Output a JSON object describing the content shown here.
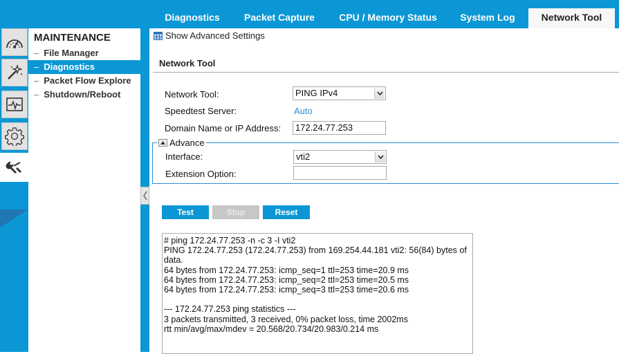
{
  "tabs": [
    {
      "label": "Diagnostics"
    },
    {
      "label": "Packet Capture"
    },
    {
      "label": "CPU / Memory Status"
    },
    {
      "label": "System Log"
    },
    {
      "label": "Network Tool",
      "active": true
    }
  ],
  "rail": [
    {
      "icon": "dashboard-icon"
    },
    {
      "icon": "wizard-icon"
    },
    {
      "icon": "monitor-icon"
    },
    {
      "icon": "gear-icon"
    },
    {
      "icon": "maintenance-tools-icon",
      "active": true
    }
  ],
  "menu": {
    "title": "MAINTENANCE",
    "dash": "–",
    "items": [
      {
        "label": "File Manager"
      },
      {
        "label": "Diagnostics",
        "active": true
      },
      {
        "label": "Packet Flow Explore"
      },
      {
        "label": "Shutdown/Reboot"
      }
    ]
  },
  "content": {
    "advanced_settings_label": "Show Advanced Settings",
    "section_title": "Network Tool",
    "form": {
      "network_tool_label": "Network Tool:",
      "network_tool_value": "PING IPv4",
      "speedtest_label": "Speedtest Server:",
      "speedtest_value": "Auto",
      "domain_label": "Domain Name or IP Address:",
      "domain_value": "172.24.77.253",
      "advance_legend": "Advance",
      "interface_label": "Interface:",
      "interface_value": "vti2",
      "extension_label": "Extension Option:",
      "extension_value": ""
    },
    "buttons": {
      "test": "Test",
      "stop": "Stop",
      "reset": "Reset"
    },
    "output": "# ping 172.24.77.253 -n -c 3 -I vti2\nPING 172.24.77.253 (172.24.77.253) from 169.254.44.181 vti2: 56(84) bytes of data.\n64 bytes from 172.24.77.253: icmp_seq=1 ttl=253 time=20.9 ms\n64 bytes from 172.24.77.253: icmp_seq=2 ttl=253 time=20.5 ms\n64 bytes from 172.24.77.253: icmp_seq=3 ttl=253 time=20.6 ms\n\n--- 172.24.77.253 ping statistics ---\n3 packets transmitted, 3 received, 0% packet loss, time 2002ms\nrtt min/avg/max/mdev = 20.568/20.734/20.983/0.214 ms"
  },
  "colors": {
    "accent": "#0b97d5",
    "link": "#2a8fd0",
    "disabled_button": "#c7c7c7"
  }
}
